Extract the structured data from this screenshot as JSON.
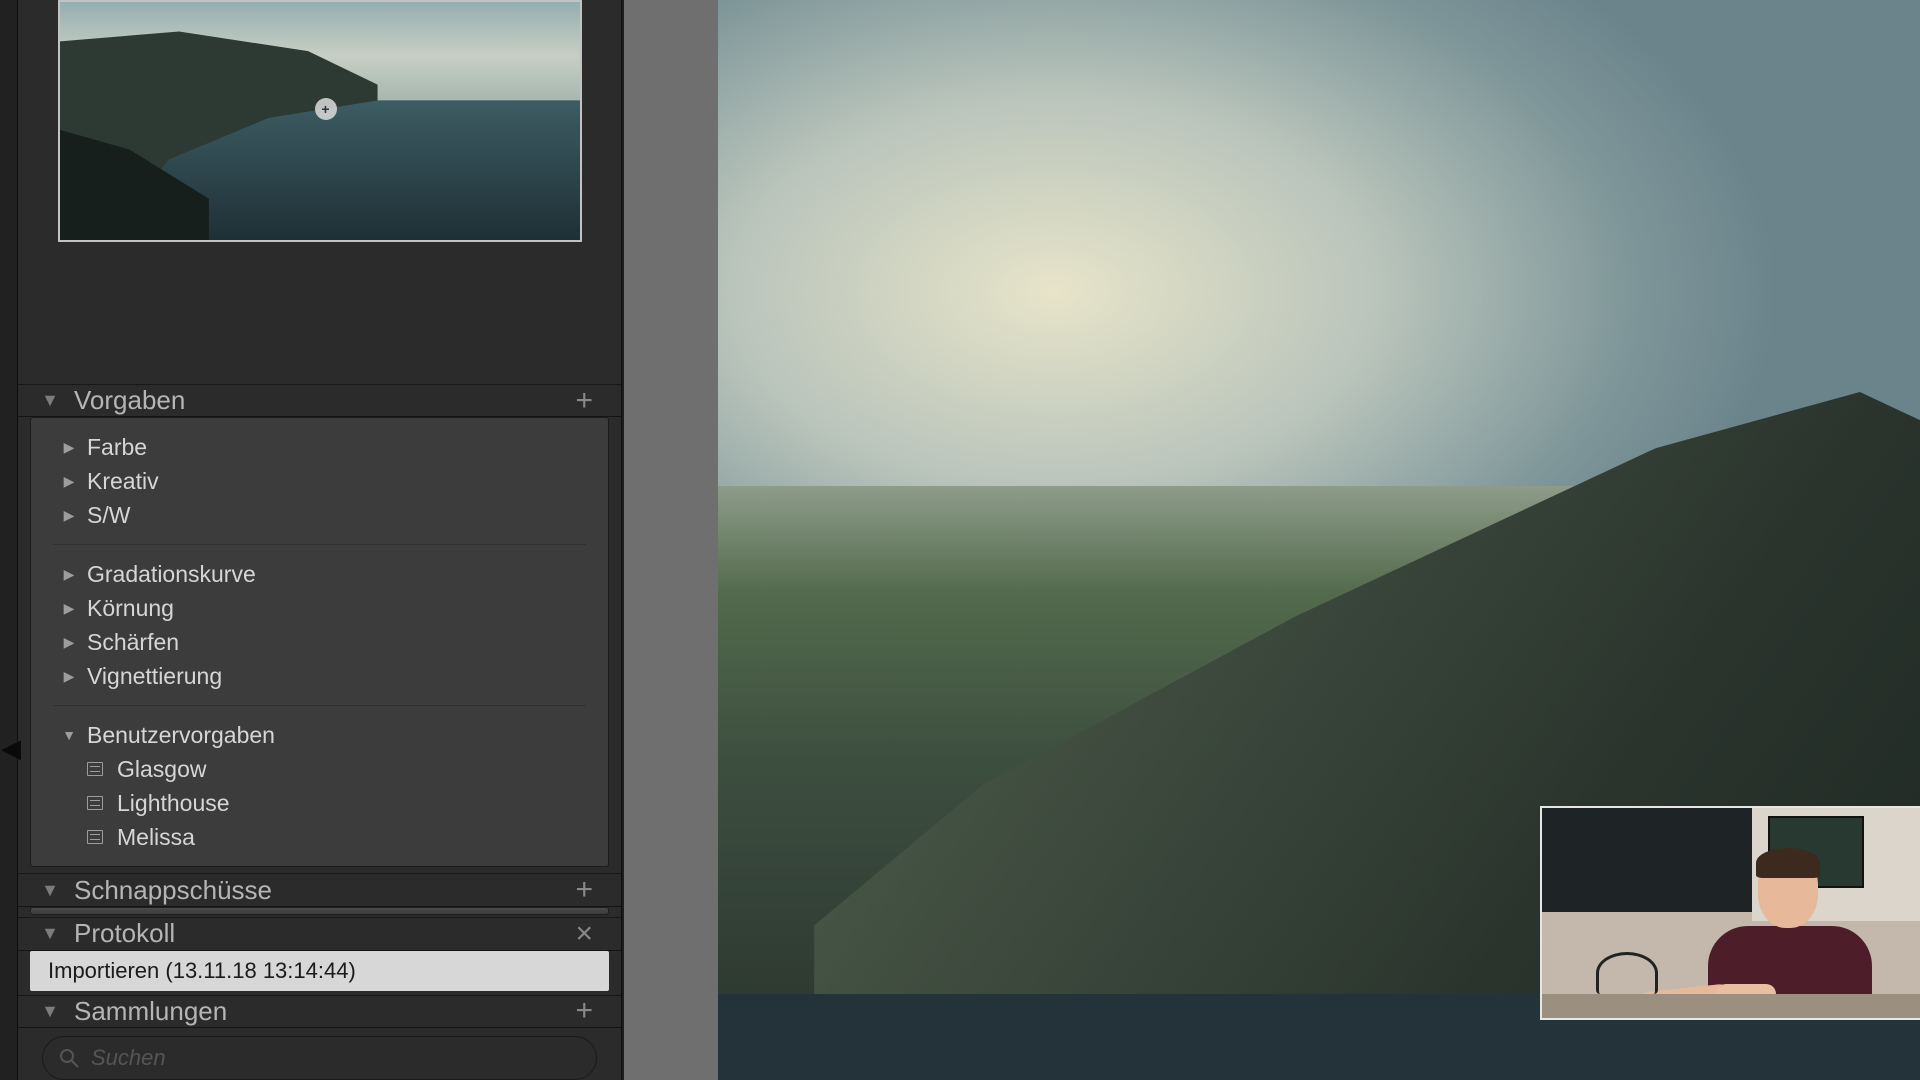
{
  "navigator": {
    "marker_glyph": "+"
  },
  "panels": {
    "presets": {
      "title": "Vorgaben",
      "add_glyph": "+",
      "groups1": [
        {
          "label": "Farbe"
        },
        {
          "label": "Kreativ"
        },
        {
          "label": "S/W"
        }
      ],
      "groups2": [
        {
          "label": "Gradationskurve"
        },
        {
          "label": "Körnung"
        },
        {
          "label": "Schärfen"
        },
        {
          "label": "Vignettierung"
        }
      ],
      "user_group_label": "Benutzervorgaben",
      "user_presets": [
        {
          "label": "Glasgow"
        },
        {
          "label": "Lighthouse"
        },
        {
          "label": "Melissa"
        }
      ]
    },
    "snapshots": {
      "title": "Schnappschüsse",
      "add_glyph": "+"
    },
    "history": {
      "title": "Protokoll",
      "close_glyph": "×",
      "entries": [
        {
          "label": "Importieren (13.11.18 13:14:44)"
        }
      ]
    },
    "collections": {
      "title": "Sammlungen",
      "add_glyph": "+",
      "search_placeholder": "Suchen"
    }
  },
  "edge_collapse_glyph": "◀"
}
